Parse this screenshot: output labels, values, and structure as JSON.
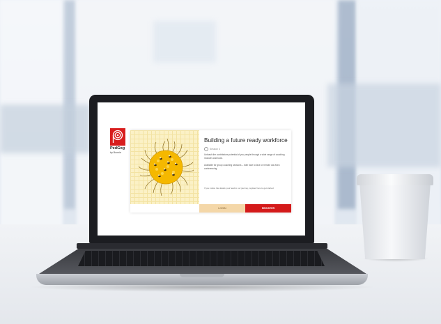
{
  "brand": {
    "name": "PedGog",
    "subtitle": "by Bunnie",
    "accent_color": "#d81d1d"
  },
  "card": {
    "title": "Building a future ready workforce",
    "meta": "Session 4",
    "description_1": "Unleash the contributors potential of you people through a wide range of coaching modules and tools.",
    "description_2": "Available for group coaching sessions – both face to face or remote via video conferencing.",
    "note": "If you notice the details your lead to our journey, register here to get started"
  },
  "buttons": {
    "login": "LOGIN",
    "register": "REGISTER"
  },
  "colors": {
    "login_bg": "#f4d7a8",
    "register_bg": "#d41a1a",
    "illustration_bg": "#fbf1c6",
    "sun": "#f5b800"
  },
  "illustration_icon": "sun-with-bees-icon"
}
